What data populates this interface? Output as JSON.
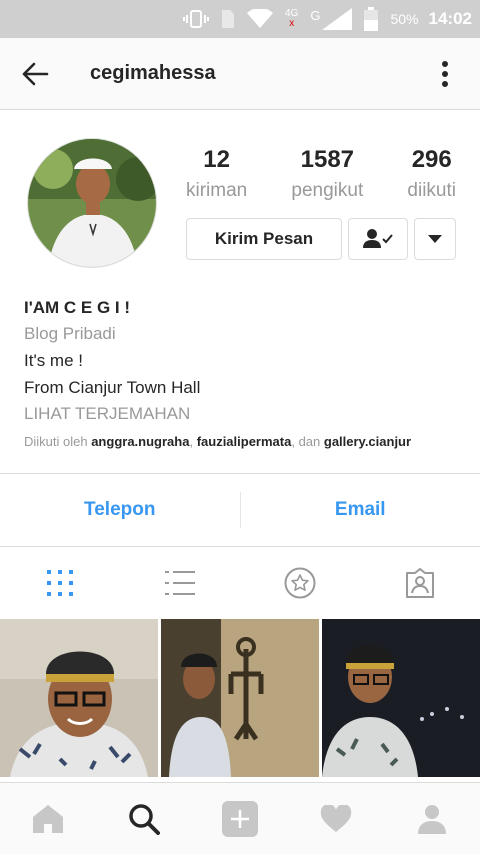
{
  "status_bar": {
    "network": "4G",
    "carrier_letter": "G",
    "battery": "50%",
    "time": "14:02"
  },
  "header": {
    "username": "cegimahessa"
  },
  "stats": [
    {
      "num": "12",
      "label": "kiriman"
    },
    {
      "num": "1587",
      "label": "pengikut"
    },
    {
      "num": "296",
      "label": "diikuti"
    }
  ],
  "actions": {
    "message_label": "Kirim Pesan"
  },
  "bio": {
    "name": "I'AM C E G I !",
    "category": "Blog Pribadi",
    "line1": "It's me !",
    "line2": "From Cianjur Town Hall",
    "translate": "LIHAT TERJEMAHAN",
    "followed_prefix": "Diikuti oleh ",
    "followed_user1": "anggra.nugraha",
    "comma": ", ",
    "followed_user2": "fauzialipermata",
    "and": ", dan ",
    "followed_user3": "gallery.cianjur"
  },
  "contact": {
    "call_label": "Telepon",
    "email_label": "Email"
  },
  "colors": {
    "accent": "#3897f0",
    "muted": "#999999",
    "text": "#262626"
  }
}
